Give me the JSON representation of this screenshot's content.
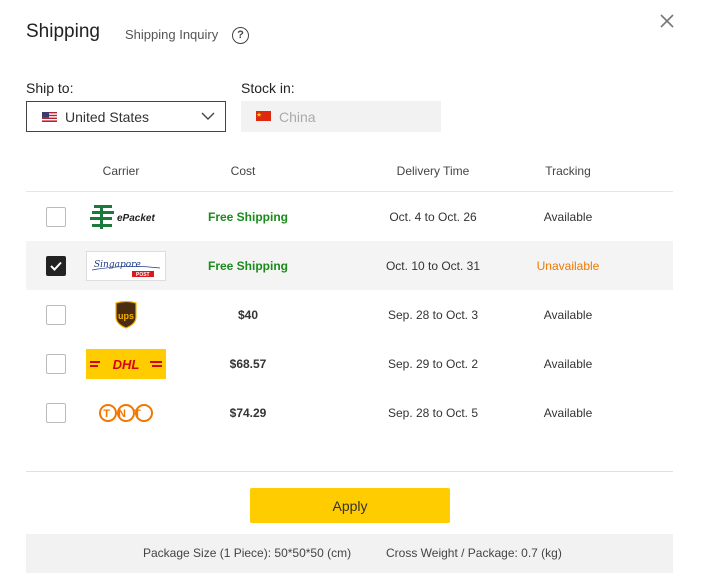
{
  "header": {
    "title": "Shipping",
    "inquiry_label": "Shipping Inquiry",
    "help_symbol": "?"
  },
  "ship_to": {
    "label": "Ship to:",
    "value": "United States"
  },
  "stock_in": {
    "label": "Stock in:",
    "value": "China"
  },
  "columns": {
    "carrier": "Carrier",
    "cost": "Cost",
    "delivery": "Delivery Time",
    "tracking": "Tracking"
  },
  "rows": [
    {
      "carrier": "ePacket",
      "logo_text": "ePacket",
      "cost": "Free Shipping",
      "delivery": "Oct. 4 to Oct. 26",
      "tracking": "Available",
      "checked": false
    },
    {
      "carrier": "Singapore Post",
      "logo_text": "Singapore",
      "logo_subtext": "POST",
      "cost": "Free Shipping",
      "delivery": "Oct. 10 to Oct. 31",
      "tracking": "Unavailable",
      "checked": true
    },
    {
      "carrier": "UPS",
      "logo_text": "ups",
      "cost": "$40",
      "delivery": "Sep. 28 to Oct. 3",
      "tracking": "Available",
      "checked": false
    },
    {
      "carrier": "DHL",
      "logo_text": "DHL",
      "cost": "$68.57",
      "delivery": "Sep. 29 to Oct. 2",
      "tracking": "Available",
      "checked": false
    },
    {
      "carrier": "TNT",
      "logo_text": "TNT",
      "cost": "$74.29",
      "delivery": "Sep. 28 to Oct. 5",
      "tracking": "Available",
      "checked": false
    }
  ],
  "apply_label": "Apply",
  "footer": {
    "package_size": "Package Size (1 Piece): 50*50*50 (cm)",
    "gross_weight": "Cross Weight / Package: 0.7 (kg)"
  },
  "colors": {
    "accent": "#ffcc00",
    "free": "#1a8a1a",
    "unavailable": "#f07800",
    "dhl": "#ffcc00",
    "tnt": "#f07800"
  }
}
